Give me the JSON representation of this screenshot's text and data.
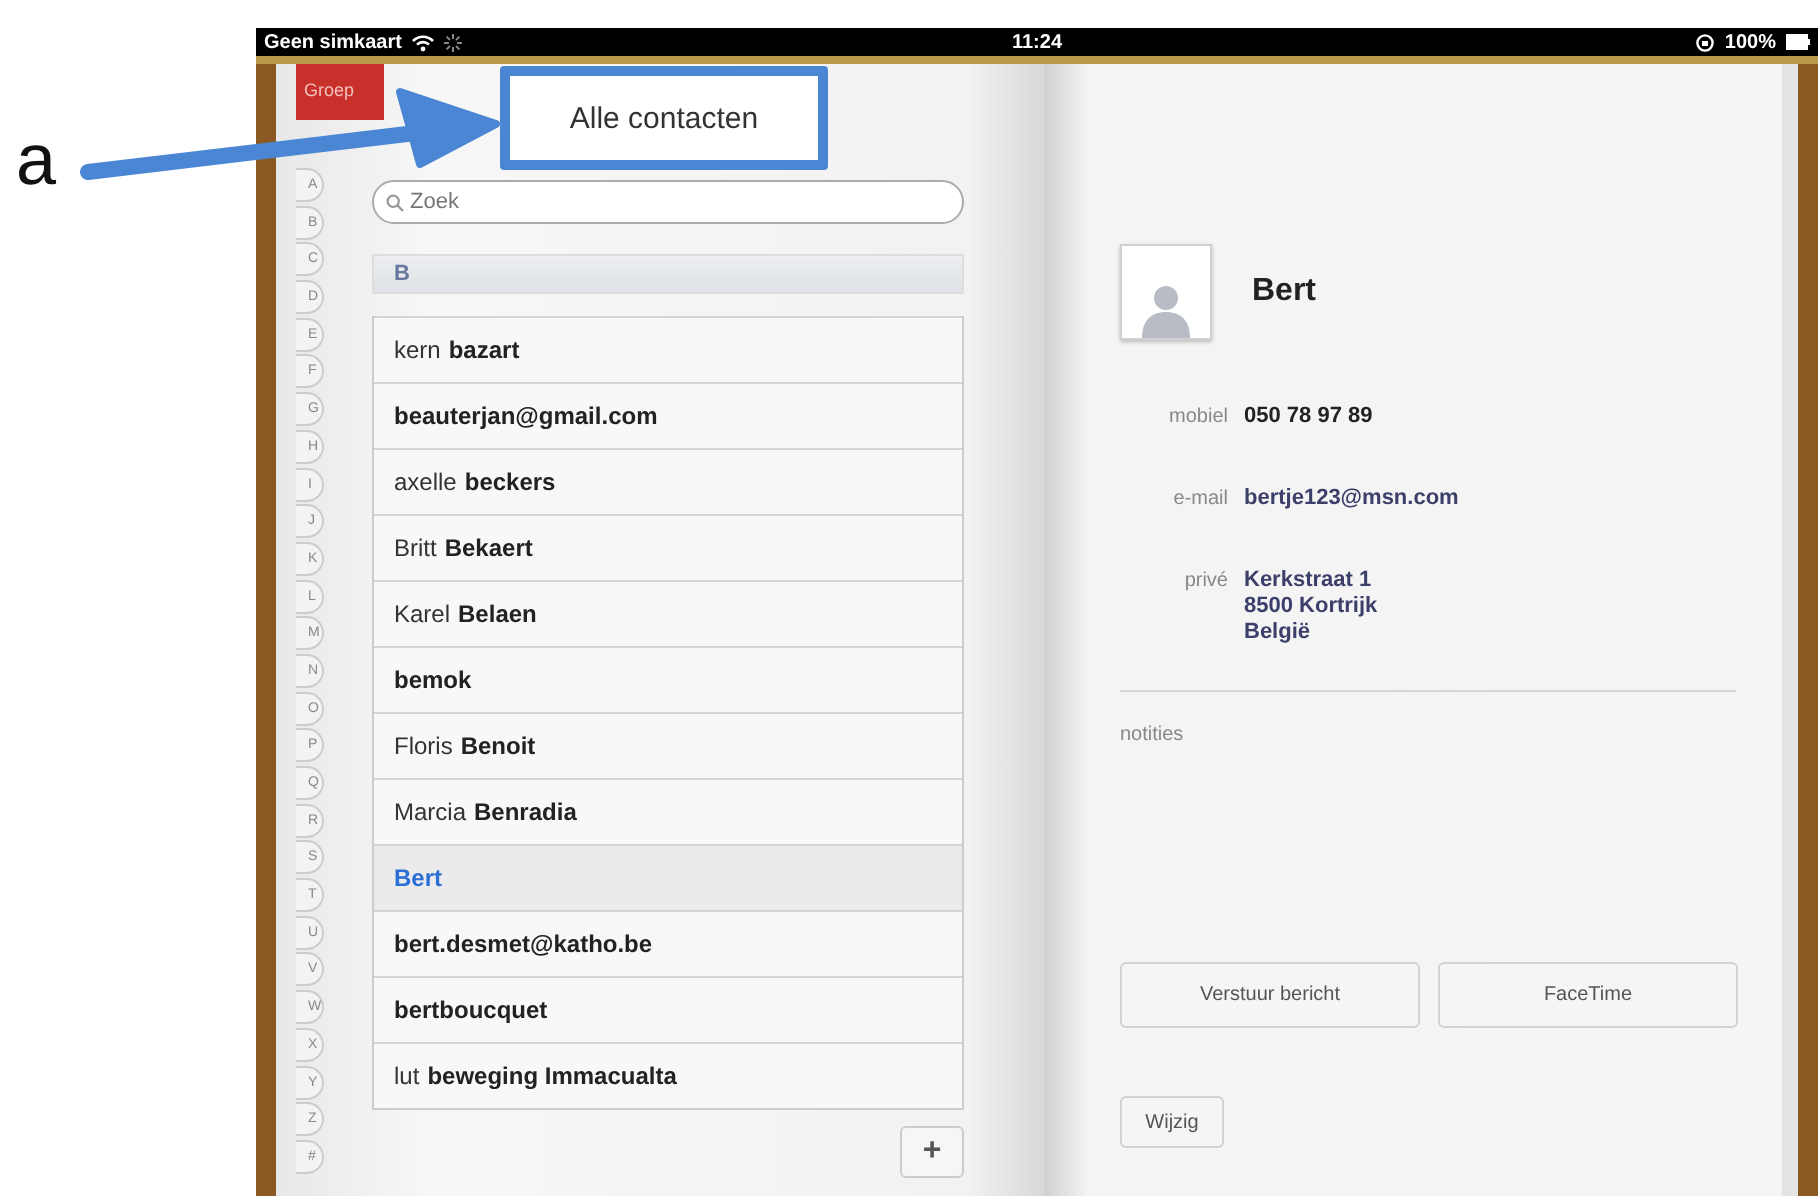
{
  "annotation": {
    "label": "a"
  },
  "status_bar": {
    "carrier": "Geen simkaart",
    "time": "11:24",
    "battery": "100%"
  },
  "groups_tab": {
    "label": "Groep"
  },
  "header": {
    "title": "Alle contacten"
  },
  "search": {
    "placeholder": "Zoek"
  },
  "index": [
    "A",
    "B",
    "C",
    "D",
    "E",
    "F",
    "G",
    "H",
    "I",
    "J",
    "K",
    "L",
    "M",
    "N",
    "O",
    "P",
    "Q",
    "R",
    "S",
    "T",
    "U",
    "V",
    "W",
    "X",
    "Y",
    "Z",
    "#"
  ],
  "section": "B",
  "contacts": [
    {
      "first": "kern",
      "last": "bazart",
      "selected": false
    },
    {
      "last": "beauterjan@gmail.com",
      "selected": false
    },
    {
      "first": "axelle",
      "last": "beckers",
      "selected": false
    },
    {
      "first": "Britt",
      "last": "Bekaert",
      "selected": false
    },
    {
      "first": "Karel",
      "last": "Belaen",
      "selected": false
    },
    {
      "last": "bemok",
      "selected": false
    },
    {
      "first": "Floris",
      "last": "Benoit",
      "selected": false
    },
    {
      "first": "Marcia",
      "last": "Benradia",
      "selected": false
    },
    {
      "last": "Bert",
      "selected": true
    },
    {
      "last": "bert.desmet@katho.be",
      "selected": false
    },
    {
      "last": "bertboucquet",
      "selected": false
    },
    {
      "first": "lut",
      "last": "beweging Immacualta",
      "selected": false
    }
  ],
  "add_button": {
    "label": "+"
  },
  "detail": {
    "name": "Bert",
    "fields": [
      {
        "label": "mobiel",
        "lines": [
          "050 78 97 89"
        ],
        "kind": "phone"
      },
      {
        "label": "e-mail",
        "lines": [
          "bertje123@msn.com"
        ],
        "kind": "link"
      },
      {
        "label": "privé",
        "lines": [
          "Kerkstraat 1",
          "8500 Kortrijk",
          "België"
        ],
        "kind": "link"
      }
    ],
    "notes_label": "notities",
    "actions": [
      "Verstuur bericht",
      "FaceTime"
    ],
    "edit_button": "Wijzig"
  }
}
